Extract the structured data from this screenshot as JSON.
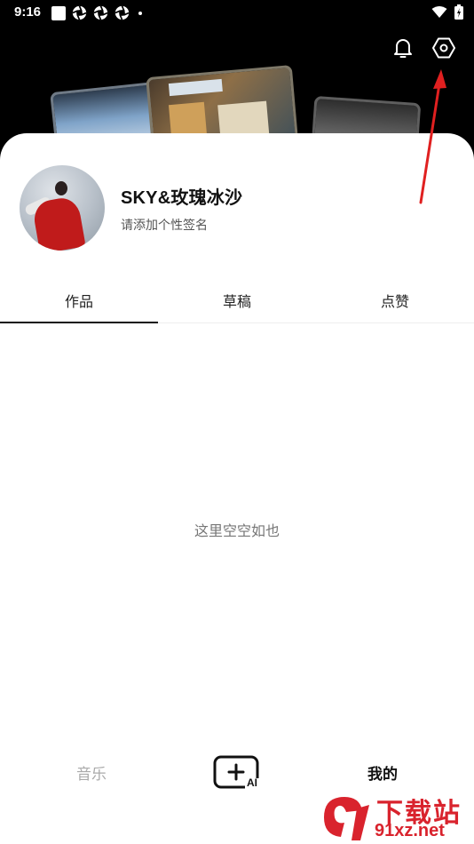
{
  "status_bar": {
    "time": "9:16"
  },
  "profile": {
    "username": "SKY&玫瑰冰沙",
    "signature": "请添加个性签名"
  },
  "tabs": [
    {
      "label": "作品",
      "active": true
    },
    {
      "label": "草稿",
      "active": false
    },
    {
      "label": "点赞",
      "active": false
    }
  ],
  "empty_message": "这里空空如也",
  "bottom_nav": {
    "music": "音乐",
    "create_badge": "AI",
    "mine": "我的"
  },
  "watermark": {
    "logo_text": "91",
    "text": "下载站",
    "url": "91xz.net"
  },
  "colors": {
    "accent_red": "#d9232d",
    "arrow_red": "#e02020"
  }
}
